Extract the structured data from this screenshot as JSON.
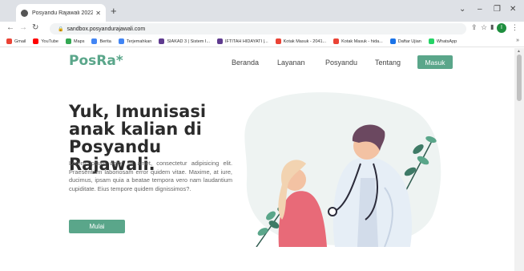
{
  "browser": {
    "tab_title": "Posyandu Rajawali 2022 | Posyan",
    "new_tab": "+",
    "url": "sandbox.posyandurajawali.com",
    "profile_initial": "I",
    "bookmarks": [
      {
        "label": "Gmail",
        "color": "#ea4335"
      },
      {
        "label": "YouTube",
        "color": "#ff0000"
      },
      {
        "label": "Maps",
        "color": "#34a853"
      },
      {
        "label": "Berita",
        "color": "#4285f4"
      },
      {
        "label": "Terjemahkan",
        "color": "#4285f4"
      },
      {
        "label": "SIAKAD 3 | Sistem I...",
        "color": "#5f3b8f"
      },
      {
        "label": "IFTITAH HIDAYATI |...",
        "color": "#5f3b8f"
      },
      {
        "label": "Kotak Masuk - 2041...",
        "color": "#ea4335"
      },
      {
        "label": "Kotak Masuk - hida...",
        "color": "#ea4335"
      },
      {
        "label": "Daftar Ujian",
        "color": "#1a73e8"
      },
      {
        "label": "WhatsApp",
        "color": "#25d366"
      }
    ],
    "more_bookmarks": "»"
  },
  "site": {
    "logo": "PosRa*",
    "nav": [
      "Beranda",
      "Layanan",
      "Posyandu",
      "Tentang"
    ],
    "login_button": "Masuk",
    "accent_color": "#5aa68a",
    "hero": {
      "title": "Yuk, Imunisasi anak kalian di Posyandu Rajawali.",
      "text": "Lorem ipsum dolor sit amet, consectetur adipisicing elit. Praesentium laboriosam error quidem vitae. Maxime, at iure, ducimus, ipsam quia a beatae tempora vero nam laudantium cupiditate. Eius tempore quidem dignissimos?.",
      "button": "Mulai"
    }
  }
}
